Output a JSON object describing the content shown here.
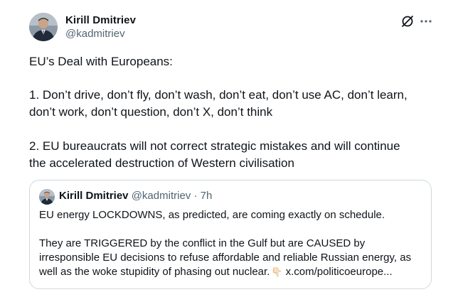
{
  "tweet": {
    "author": {
      "name": "Kirill Dmitriev",
      "handle": "@kadmitriev"
    },
    "lines": [
      "EU’s Deal with Europeans:",
      "1. Don’t drive, don’t fly, don’t wash, don’t eat, don’t use AC, don’t learn,",
      "don’t work, don’t question, don’t X, don’t think",
      "2. EU bureaucrats will not correct strategic mistakes and will continue",
      "the accelerated destruction of Western civilisation"
    ],
    "icons": {
      "grok": "grok-icon",
      "more": "more-icon"
    }
  },
  "quote": {
    "name": "Kirill Dmitriev",
    "meta": "@kadmitriev · 7h",
    "lines": [
      "EU energy LOCKDOWNS, as predicted, are coming exactly on schedule.",
      "They are TRIGGERED by the conflict in the Gulf but are CAUSED by",
      "irresponsible EU decisions to refuse affordable and reliable Russian energy, as",
      "well as the woke stupidity of phasing out nuclear."
    ],
    "emoji": "👇🏻",
    "link": "x.com/politicoeurope..."
  },
  "colors": {
    "text": "#0f1419",
    "secondary": "#536471",
    "border": "#cfd9de"
  }
}
